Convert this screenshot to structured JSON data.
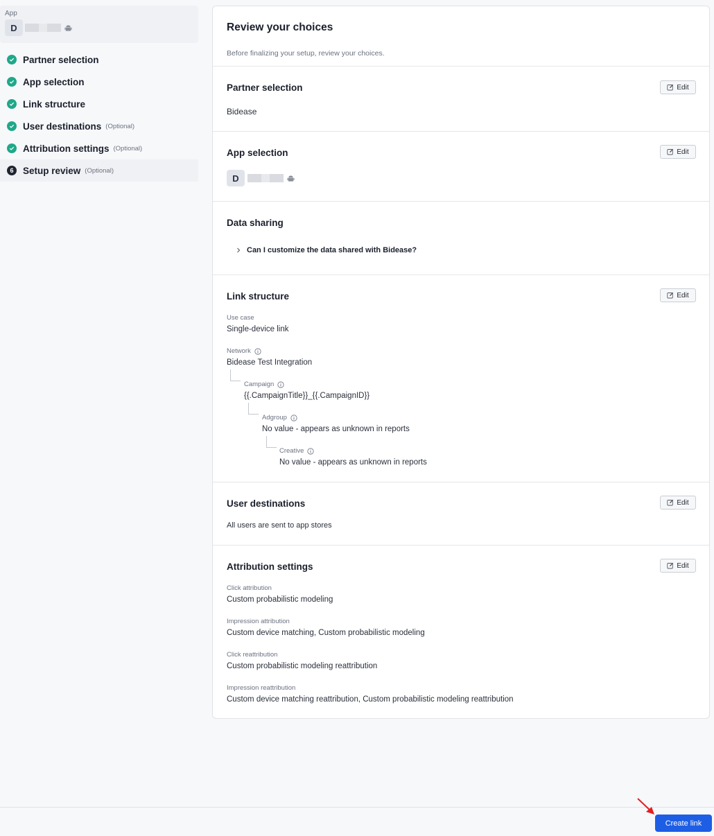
{
  "sidebar": {
    "app_label": "App",
    "app_initial": "D",
    "steps": [
      {
        "label": "Partner selection",
        "optional": "",
        "status": "done"
      },
      {
        "label": "App selection",
        "optional": "",
        "status": "done"
      },
      {
        "label": "Link structure",
        "optional": "",
        "status": "done"
      },
      {
        "label": "User destinations",
        "optional": "(Optional)",
        "status": "done"
      },
      {
        "label": "Attribution settings",
        "optional": "(Optional)",
        "status": "done"
      },
      {
        "label": "Setup review",
        "optional": "(Optional)",
        "status": "current",
        "number": "6"
      }
    ]
  },
  "review": {
    "title": "Review your choices",
    "subtitle": "Before finalizing your setup, review your choices."
  },
  "edit_label": "Edit",
  "partner": {
    "title": "Partner selection",
    "value": "Bidease"
  },
  "app": {
    "title": "App selection",
    "initial": "D"
  },
  "data_sharing": {
    "title": "Data sharing",
    "faq": "Can I customize the data shared with Bidease?"
  },
  "link": {
    "title": "Link structure",
    "use_case_label": "Use case",
    "use_case": "Single-device link",
    "network_label": "Network",
    "network": "Bidease Test Integration",
    "campaign_label": "Campaign",
    "campaign": "{{.CampaignTitle}}_{{.CampaignID}}",
    "adgroup_label": "Adgroup",
    "adgroup": "No value - appears as unknown in reports",
    "creative_label": "Creative",
    "creative": "No value - appears as unknown in reports"
  },
  "destinations": {
    "title": "User destinations",
    "value": "All users are sent to app stores"
  },
  "attribution": {
    "title": "Attribution settings",
    "items": [
      {
        "label": "Click attribution",
        "value": "Custom probabilistic modeling"
      },
      {
        "label": "Impression attribution",
        "value": "Custom device matching, Custom probabilistic modeling"
      },
      {
        "label": "Click reattribution",
        "value": "Custom probabilistic modeling reattribution"
      },
      {
        "label": "Impression reattribution",
        "value": "Custom device matching reattribution, Custom probabilistic modeling reattribution"
      }
    ]
  },
  "create_button": "Create link",
  "colors": {
    "accent": "#1d5ee5",
    "check": "#1fa88a",
    "arrow": "#e02020"
  }
}
